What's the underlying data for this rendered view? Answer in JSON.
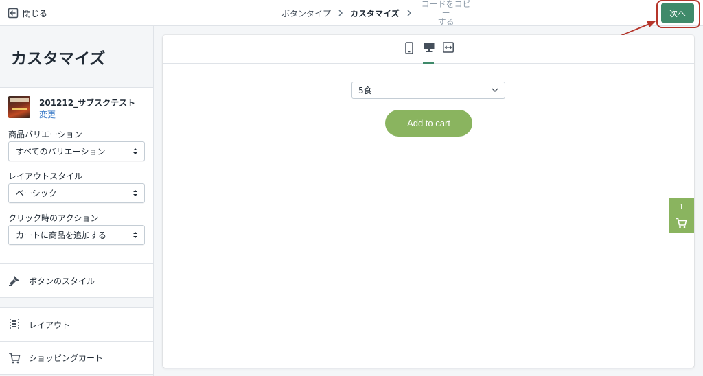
{
  "header": {
    "close_label": "閉じる",
    "breadcrumbs": [
      {
        "label": "ボタンタイプ",
        "state": "done"
      },
      {
        "label": "カスタマイズ",
        "state": "current"
      },
      {
        "label": "コードをコピー\nする",
        "label_line1": "コードをコピー",
        "label_line2": "する",
        "state": "upcoming"
      }
    ],
    "next_label": "次へ"
  },
  "sidebar": {
    "title": "カスタマイズ",
    "product": {
      "name": "201212_サブスクテスト",
      "change_label": "変更"
    },
    "fields": [
      {
        "label": "商品バリエーション",
        "value": "すべてのバリエーション"
      },
      {
        "label": "レイアウトスタイル",
        "value": "ベーシック"
      },
      {
        "label": "クリック時のアクション",
        "value": "カートに商品を追加する"
      }
    ],
    "sections": [
      {
        "label": "ボタンのスタイル",
        "icon": "paint-brush-icon"
      },
      {
        "label": "レイアウト",
        "icon": "layout-list-icon"
      },
      {
        "label": "ショッピングカート",
        "icon": "cart-icon"
      }
    ]
  },
  "preview": {
    "devices": [
      {
        "name": "mobile",
        "icon": "mobile-icon",
        "active": false
      },
      {
        "name": "desktop",
        "icon": "desktop-icon",
        "active": true
      },
      {
        "name": "full-width",
        "icon": "expand-width-icon",
        "active": false
      }
    ],
    "variant_value": "5食",
    "add_to_cart_label": "Add to cart",
    "cart_count": "1"
  },
  "colors": {
    "primary": "#3f8a6a",
    "button_green": "#8ab45f",
    "link_blue": "#3778c6",
    "annotation_red": "#b5352b"
  }
}
